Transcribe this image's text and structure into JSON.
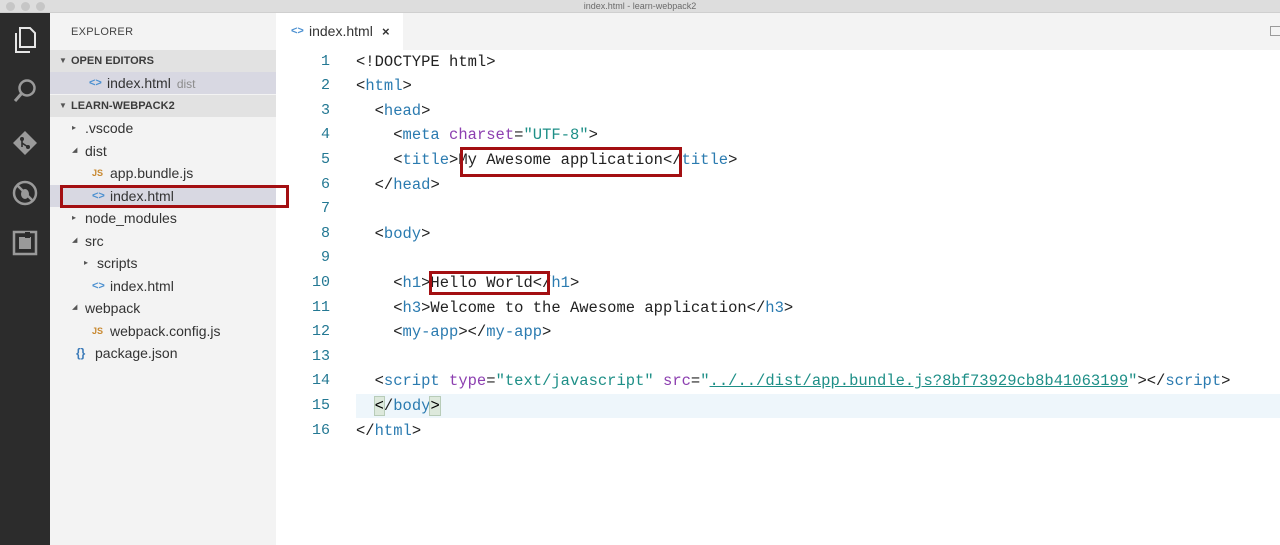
{
  "window": {
    "title": "index.html - learn-webpack2"
  },
  "activity_bar": [
    {
      "icon": "files-icon"
    },
    {
      "icon": "search-icon"
    },
    {
      "icon": "git-icon"
    },
    {
      "icon": "debug-icon"
    },
    {
      "icon": "extensions-icon"
    }
  ],
  "sidebar": {
    "title": "EXPLORER",
    "open_editors": {
      "header": "OPEN EDITORS",
      "items": [
        {
          "label": "index.html",
          "hint": "dist"
        }
      ]
    },
    "project": {
      "header": "LEARN-WEBPACK2",
      "tree": [
        {
          "label": ".vscode",
          "type": "folder",
          "expanded": false,
          "depth": 0
        },
        {
          "label": "dist",
          "type": "folder",
          "expanded": true,
          "depth": 0
        },
        {
          "label": "app.bundle.js",
          "type": "js",
          "depth": 1
        },
        {
          "label": "index.html",
          "type": "html",
          "depth": 1,
          "selected": true
        },
        {
          "label": "node_modules",
          "type": "folder",
          "expanded": false,
          "depth": 0
        },
        {
          "label": "src",
          "type": "folder",
          "expanded": true,
          "depth": 0
        },
        {
          "label": "scripts",
          "type": "folder",
          "expanded": false,
          "depth": 1
        },
        {
          "label": "index.html",
          "type": "html",
          "depth": 1
        },
        {
          "label": "webpack",
          "type": "folder",
          "expanded": true,
          "depth": 0
        },
        {
          "label": "webpack.config.js",
          "type": "js",
          "depth": 1
        },
        {
          "label": "package.json",
          "type": "json",
          "depth": 0
        }
      ]
    }
  },
  "icons": {
    "html": "<>",
    "js": "JS",
    "json": "{}"
  },
  "tab": {
    "label": "index.html",
    "close": "×"
  },
  "editor": {
    "highlighted_line": 15,
    "lines": [
      [
        [
          "d",
          "<!DOCTYPE html>"
        ]
      ],
      [
        [
          "d",
          "<"
        ],
        [
          "t",
          "html"
        ],
        [
          "d",
          ">"
        ]
      ],
      [
        [
          "d",
          "  <"
        ],
        [
          "t",
          "head"
        ],
        [
          "d",
          ">"
        ]
      ],
      [
        [
          "d",
          "    <"
        ],
        [
          "t",
          "meta"
        ],
        [
          "d",
          " "
        ],
        [
          "a",
          "charset"
        ],
        [
          "d",
          "="
        ],
        [
          "s",
          "\"UTF-8\""
        ],
        [
          "d",
          ">"
        ]
      ],
      [
        [
          "d",
          "    <"
        ],
        [
          "t",
          "title"
        ],
        [
          "d",
          ">My Awesome application</"
        ],
        [
          "t",
          "title"
        ],
        [
          "d",
          ">"
        ]
      ],
      [
        [
          "d",
          "  </"
        ],
        [
          "t",
          "head"
        ],
        [
          "d",
          ">"
        ]
      ],
      [],
      [
        [
          "d",
          "  <"
        ],
        [
          "t",
          "body"
        ],
        [
          "d",
          ">"
        ]
      ],
      [],
      [
        [
          "d",
          "    <"
        ],
        [
          "t",
          "h1"
        ],
        [
          "d",
          ">Hello World</"
        ],
        [
          "t",
          "h1"
        ],
        [
          "d",
          ">"
        ]
      ],
      [
        [
          "d",
          "    <"
        ],
        [
          "t",
          "h3"
        ],
        [
          "d",
          ">Welcome to the Awesome application</"
        ],
        [
          "t",
          "h3"
        ],
        [
          "d",
          ">"
        ]
      ],
      [
        [
          "d",
          "    <"
        ],
        [
          "t",
          "my-app"
        ],
        [
          "d",
          "></"
        ],
        [
          "t",
          "my-app"
        ],
        [
          "d",
          ">"
        ]
      ],
      [],
      [
        [
          "d",
          "  <"
        ],
        [
          "t",
          "script"
        ],
        [
          "d",
          " "
        ],
        [
          "a",
          "type"
        ],
        [
          "d",
          "="
        ],
        [
          "s",
          "\"text/javascript\""
        ],
        [
          "d",
          " "
        ],
        [
          "a",
          "src"
        ],
        [
          "d",
          "="
        ],
        [
          "s",
          "\""
        ],
        [
          "u",
          "../../dist/app.bundle.js?8bf73929cb8b41063199"
        ],
        [
          "s",
          "\""
        ],
        [
          "d",
          "></"
        ],
        [
          "t",
          "script"
        ],
        [
          "d",
          ">"
        ]
      ],
      [
        [
          "d",
          "  "
        ],
        [
          "bm",
          "<"
        ],
        [
          "d",
          "/"
        ],
        [
          "t",
          "body"
        ],
        [
          "bm",
          ">"
        ]
      ],
      [
        [
          "d",
          "</"
        ],
        [
          "t",
          "html"
        ],
        [
          "d",
          ">"
        ]
      ]
    ]
  }
}
